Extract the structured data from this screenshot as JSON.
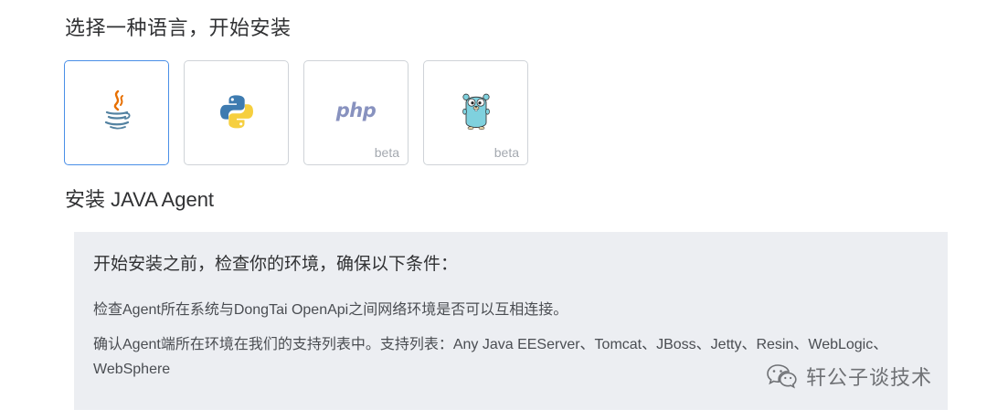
{
  "page": {
    "title": "选择一种语言，开始安装"
  },
  "languages": [
    {
      "name": "Java",
      "icon": "java-icon",
      "selected": true,
      "badge": ""
    },
    {
      "name": "Python",
      "icon": "python-icon",
      "selected": false,
      "badge": ""
    },
    {
      "name": "PHP",
      "icon": "php-logo",
      "logo_text": "php",
      "selected": false,
      "badge": "beta"
    },
    {
      "name": "Go",
      "icon": "go-gopher-icon",
      "selected": false,
      "badge": "beta"
    }
  ],
  "install": {
    "title": "安装 JAVA Agent",
    "heading": "开始安装之前，检查你的环境，确保以下条件：",
    "conditions": [
      "检查Agent所在系统与DongTai OpenApi之间网络环境是否可以互相连接。",
      "确认Agent端所在环境在我们的支持列表中。支持列表：Any Java EEServer、Tomcat、JBoss、Jetty、Resin、WebLogic、WebSphere"
    ]
  },
  "watermark": {
    "text": "轩公子谈技术",
    "icon": "wechat-icon"
  },
  "colors": {
    "selected_border": "#4a8fe7",
    "card_border": "#cfd3d8",
    "info_background": "#eceef2",
    "java_red": "#e76f00",
    "java_blue": "#5382a1",
    "python_blue": "#3e7bb0",
    "python_yellow": "#f6cf3f",
    "php_purple": "#8892bf",
    "go_cyan": "#7fd1de"
  }
}
